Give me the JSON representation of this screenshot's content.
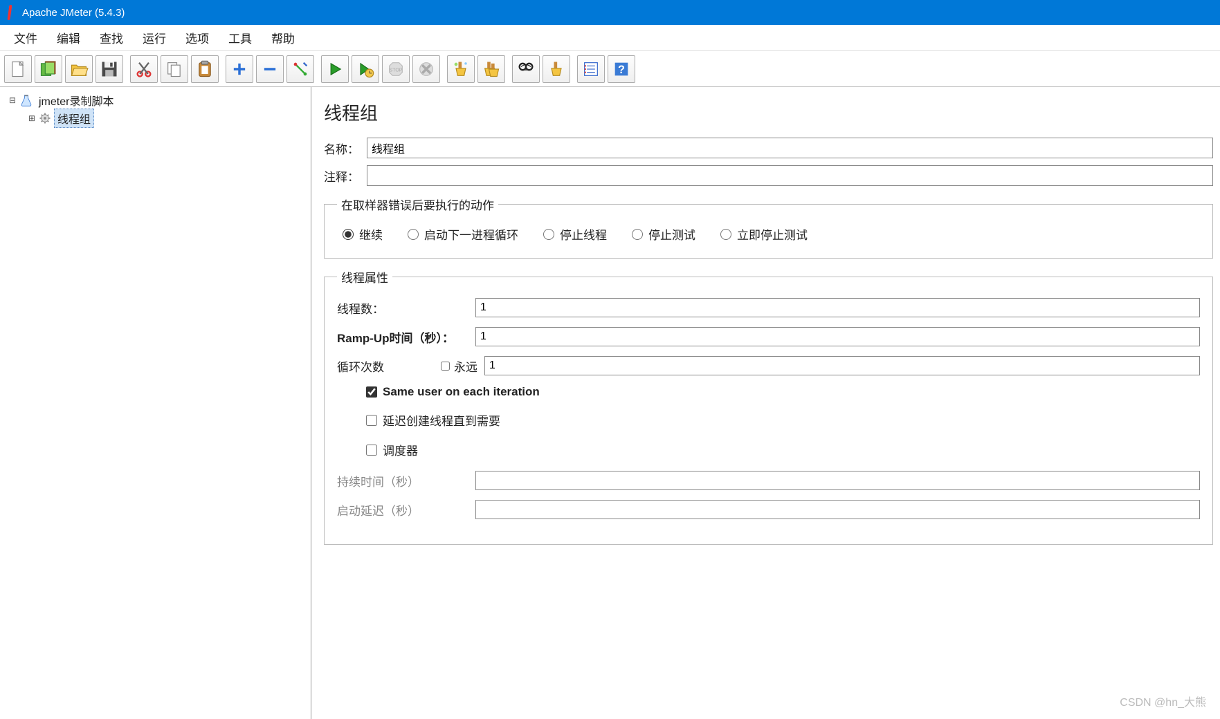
{
  "title": "Apache JMeter (5.4.3)",
  "menu": {
    "file": "文件",
    "edit": "编辑",
    "search": "查找",
    "run": "运行",
    "options": "选项",
    "tools": "工具",
    "help": "帮助"
  },
  "toolbar_icons": {
    "new": "new-file-icon",
    "templates": "templates-icon",
    "open": "open-icon",
    "save": "save-icon",
    "cut": "cut-icon",
    "copy": "copy-icon",
    "paste": "paste-icon",
    "plus": "plus-icon",
    "minus": "minus-icon",
    "toggle": "toggle-icon",
    "start": "start-icon",
    "start_no_timers": "start-no-timers-icon",
    "stop": "stop-icon",
    "shutdown": "shutdown-icon",
    "clear": "clear-icon",
    "clear_all": "clear-all-icon",
    "search": "search-icon",
    "reset_search": "reset-search-icon",
    "function": "function-helper-icon",
    "help": "help-icon"
  },
  "tree": {
    "root": "jmeter录制脚本",
    "child": "线程组"
  },
  "panel": {
    "heading": "线程组",
    "name_label": "名称：",
    "name_value": "线程组",
    "comment_label": "注释：",
    "comment_value": "",
    "error_action": {
      "legend": "在取样器错误后要执行的动作",
      "continue": "继续",
      "next_loop": "启动下一进程循环",
      "stop_thread": "停止线程",
      "stop_test": "停止测试",
      "stop_now": "立即停止测试",
      "selected": "continue"
    },
    "thread_props": {
      "legend": "线程属性",
      "threads_label": "线程数：",
      "threads_value": "1",
      "rampup_label": "Ramp-Up时间（秒）：",
      "rampup_value": "1",
      "loop_label": "循环次数",
      "forever_label": "永远",
      "loop_value": "1",
      "same_user": "Same user on each iteration",
      "delay_create": "延迟创建线程直到需要",
      "scheduler": "调度器",
      "duration_label": "持续时间（秒）",
      "duration_value": "",
      "startup_delay_label": "启动延迟（秒）",
      "startup_delay_value": ""
    }
  },
  "watermark": "CSDN @hn_大熊"
}
